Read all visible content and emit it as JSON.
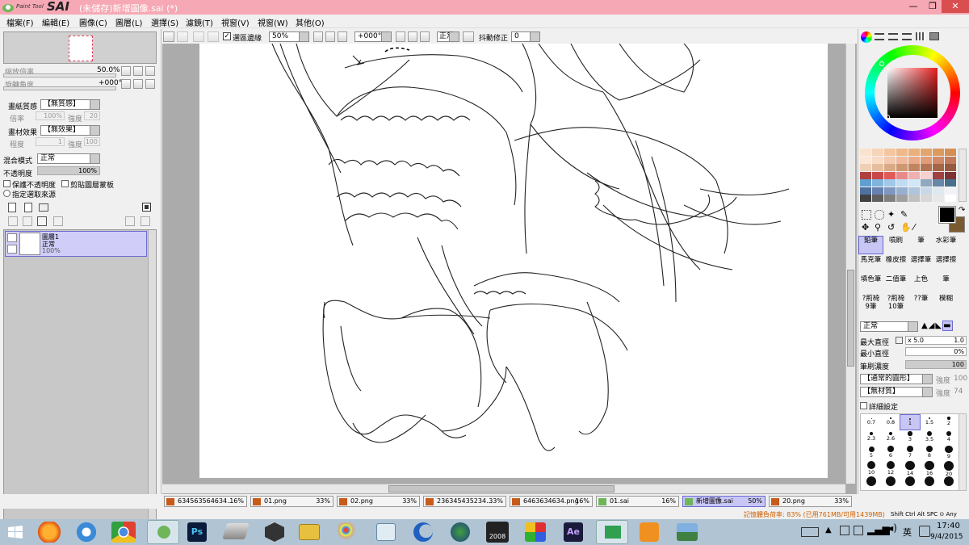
{
  "window": {
    "app_name": "Paint Tool",
    "app_logo": "SAI",
    "title": "(未儲存)新增圖像.sai (*)",
    "controls": [
      "—",
      "❐",
      "✕"
    ]
  },
  "menu": [
    "檔案(F)",
    "編輯(E)",
    "圖像(C)",
    "圖層(L)",
    "選擇(S)",
    "濾鏡(T)",
    "視窗(V)",
    "視窗(W)",
    "其他(O)"
  ],
  "toolbar": {
    "select_edge_label": "選區邊緣",
    "zoom": "50%",
    "rotation": "+000°",
    "blend": "正常",
    "stabilizer_label": "抖動修正",
    "stabilizer": "0"
  },
  "navigator": {
    "zoom_label": "縮放倍率",
    "zoom_value": "50.0%",
    "rotate_label": "旋轉角度",
    "rotate_value": "+000°"
  },
  "layer_props": {
    "paper_label": "畫紙質感",
    "paper_value": "【無質感】",
    "scale_label": "倍率",
    "scale_value": "100%",
    "strength_label": "強度",
    "strength_value": "20",
    "effect_label": "畫材效果",
    "effect_value": "【無效果】",
    "degree_label": "程度",
    "degree_value": "1",
    "strength2_label": "強度",
    "strength2_value": "100",
    "blend_label": "混合模式",
    "blend_value": "正常",
    "opacity_label": "不透明度",
    "opacity_value": "100%",
    "opacity": 1.0,
    "keep_opacity": "保護不透明度",
    "clip_mask": "剪貼圖層蒙板",
    "sel_source": "指定選取來源"
  },
  "layers": [
    {
      "name": "圖層1",
      "mode": "正常",
      "opacity": "100%"
    }
  ],
  "color": {
    "current_fg": "#000000",
    "current_bg": "#7a5a30",
    "palette": [
      "#f9e3cf",
      "#f7d5b8",
      "#f4c6a0",
      "#f0b98a",
      "#eab07c",
      "#e3a56d",
      "#dc9a5f",
      "#d58f52",
      "#fbe7d7",
      "#f9dcc6",
      "#f4c9b0",
      "#efba9e",
      "#e8aa89",
      "#e09c77",
      "#d18968",
      "#c27a5a",
      "#eed0b6",
      "#e5bea0",
      "#d9aa86",
      "#cd9770",
      "#c08560",
      "#b27452",
      "#a56547",
      "#955a3f",
      "#b04040",
      "#c84848",
      "#e05a5a",
      "#e88a8a",
      "#f0b0b0",
      "#f7d0d0",
      "#a04040",
      "#7e3232",
      "#60a0d0",
      "#80b4dc",
      "#a0c8e8",
      "#c0dcf2",
      "#d0e8f8",
      "#90a8c0",
      "#6888a8",
      "#48708e",
      "#5070a0",
      "#6880b0",
      "#8098c0",
      "#98b0d0",
      "#b0c4dc",
      "#c8d8e8",
      "#e0e8f0",
      "#f0f4f8",
      "#404040",
      "#606060",
      "#808080",
      "#a0a0a0",
      "#c0c0c0",
      "#d8d8d8",
      "#e8e8e8",
      "#ffffff"
    ]
  },
  "tools": [
    {
      "label": "鉛筆"
    },
    {
      "label": "噴刷"
    },
    {
      "label": "筆"
    },
    {
      "label": "水彩筆"
    },
    {
      "label": "馬克筆"
    },
    {
      "label": "橡皮擦"
    },
    {
      "label": "選擇筆"
    },
    {
      "label": "選擇擦"
    },
    {
      "label": "填色筆"
    },
    {
      "label": "二值筆"
    },
    {
      "label": "上色"
    },
    {
      "label": "筆"
    },
    {
      "label": "?荊椅 9筆"
    },
    {
      "label": "?荊椅 10筆"
    },
    {
      "label": "??筆"
    },
    {
      "label": "模糊"
    }
  ],
  "brush": {
    "mode": "正常",
    "max_label": "最大直徑",
    "max_mult": "x 5.0",
    "max_value": "1.0",
    "min_label": "最小直徑",
    "min_value": "0%",
    "density_label": "筆刷濃度",
    "density_value": "100",
    "shape": "【通常的圓形】",
    "shape_strength_label": "強度",
    "shape_strength": "100",
    "texture": "【無材質】",
    "texture_strength_label": "強度",
    "texture_strength": "74",
    "detail_label": "詳細設定",
    "sizes": [
      "0.7",
      "0.8",
      "1",
      "1.5",
      "2",
      "2.3",
      "2.6",
      "3",
      "3.5",
      "4",
      "5",
      "6",
      "7",
      "8",
      "9",
      "10",
      "12",
      "14",
      "16",
      "20",
      "",
      "",
      "",
      "",
      ""
    ]
  },
  "tabs": [
    {
      "name": "634563564634...",
      "pct": "16%"
    },
    {
      "name": "01.png",
      "pct": "33%"
    },
    {
      "name": "02.png",
      "pct": "33%"
    },
    {
      "name": "236345435234...",
      "pct": "33%"
    },
    {
      "name": "6463634634.png",
      "pct": "16%"
    },
    {
      "name": "01.sai",
      "pct": "16%"
    },
    {
      "name": "新增圖像.sai",
      "pct": "50%"
    },
    {
      "name": "20.png",
      "pct": "33%"
    }
  ],
  "status": {
    "memory": "記憶體負荷率: 83% (已用761MB/可用1439MB)",
    "keys": [
      "Shift",
      "Ctrl",
      "Alt",
      "SPC",
      "⊙",
      "Any"
    ]
  },
  "taskbar": {
    "time": "17:40",
    "date": "9/4/2015",
    "ime": "英",
    "icons": [
      "windows-start-icon",
      "firefox-icon",
      "ie-icon",
      "chrome-icon",
      "sai-icon",
      "photoshop-icon",
      "scanner-icon",
      "unity-icon",
      "folder-icon",
      "paint-icon",
      "photo-viewer-icon",
      "crescent-icon",
      "globe-icon",
      "game-2008-icon",
      "colors-icon",
      "after-effects-icon",
      "green-window-icon",
      "media-player-icon",
      "landscape-icon"
    ],
    "labels": {
      "ps": "Ps",
      "ae": "Ae",
      "game": "2008"
    }
  }
}
